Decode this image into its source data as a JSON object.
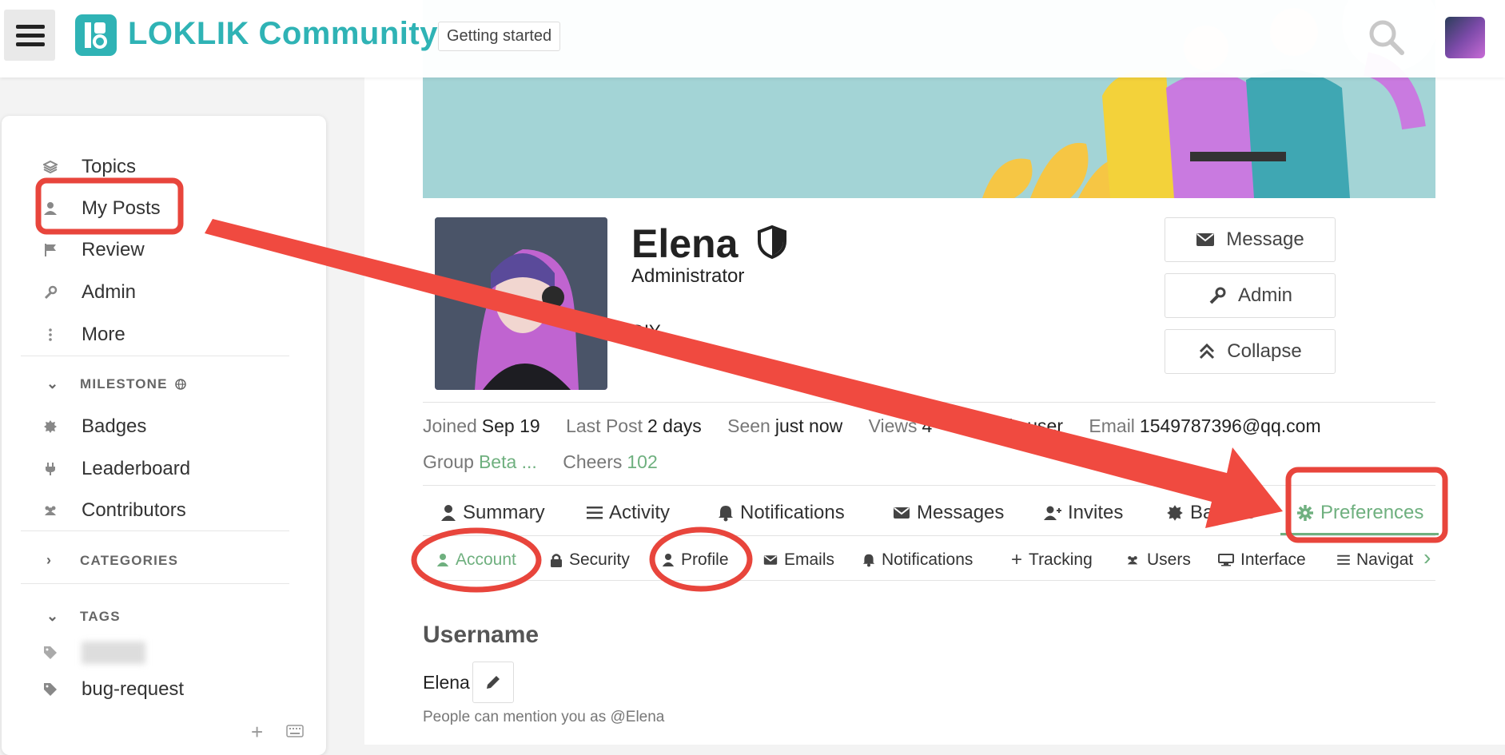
{
  "header": {
    "logo_text": "LOKLIK Community",
    "getting_started": "Getting started"
  },
  "sidebar": {
    "items": [
      {
        "label": "Topics",
        "icon": "layers-icon"
      },
      {
        "label": "My Posts",
        "icon": "user-icon"
      },
      {
        "label": "Review",
        "icon": "flag-icon"
      },
      {
        "label": "Admin",
        "icon": "wrench-icon"
      },
      {
        "label": "More",
        "icon": "more-vertical-icon"
      }
    ],
    "milestone_header": "MILESTONE",
    "milestone_items": [
      {
        "label": "Badges",
        "icon": "badge-icon"
      },
      {
        "label": "Leaderboard",
        "icon": "plug-icon"
      },
      {
        "label": "Contributors",
        "icon": "users-icon"
      }
    ],
    "categories_header": "CATEGORIES",
    "tags_header": "TAGS",
    "tags": [
      {
        "label": "",
        "icon": "tag-icon"
      },
      {
        "label": "bug-request",
        "icon": "tag-icon"
      }
    ]
  },
  "profile": {
    "name": "Elena",
    "role": "Administrator",
    "bio_fragment": "DIY",
    "buttons": {
      "message": "Message",
      "admin": "Admin",
      "collapse": "Collapse"
    },
    "stats_row1": [
      {
        "label": "Joined",
        "value": "Sep 19"
      },
      {
        "label": "Last Post",
        "value": "2 days"
      },
      {
        "label": "Seen",
        "value": "just now"
      },
      {
        "label": "Views",
        "value": "4"
      },
      {
        "label": "Tr",
        "value": "basic user"
      },
      {
        "label": "Email",
        "value": "1549787396@qq.com"
      }
    ],
    "stats_row2": [
      {
        "label": "Group",
        "value": "Beta ..."
      },
      {
        "label": "Cheers",
        "value": "102"
      }
    ]
  },
  "tabs": [
    {
      "label": "Summary",
      "icon": "user-icon"
    },
    {
      "label": "Activity",
      "icon": "list-icon"
    },
    {
      "label": "Notifications",
      "icon": "bell-icon"
    },
    {
      "label": "Messages",
      "icon": "envelope-icon"
    },
    {
      "label": "Invites",
      "icon": "user-plus-icon"
    },
    {
      "label": "Badges",
      "icon": "badge-icon"
    },
    {
      "label": "Preferences",
      "icon": "gear-icon",
      "active": true
    }
  ],
  "subtabs": [
    {
      "label": "Account",
      "icon": "user-icon",
      "active": true
    },
    {
      "label": "Security",
      "icon": "lock-icon"
    },
    {
      "label": "Profile",
      "icon": "user-icon"
    },
    {
      "label": "Emails",
      "icon": "envelope-icon"
    },
    {
      "label": "Notifications",
      "icon": "bell-icon"
    },
    {
      "label": "Tracking",
      "icon": "plus-icon"
    },
    {
      "label": "Users",
      "icon": "users-icon"
    },
    {
      "label": "Interface",
      "icon": "desktop-icon"
    },
    {
      "label": "Navigat",
      "icon": "list-icon"
    }
  ],
  "account": {
    "username_label": "Username",
    "username_value": "Elena",
    "helper_text": "People can mention you as @Elena"
  },
  "colors": {
    "brand": "#2fb3b5",
    "active": "#6fb07f",
    "annotation": "#e8453c"
  }
}
